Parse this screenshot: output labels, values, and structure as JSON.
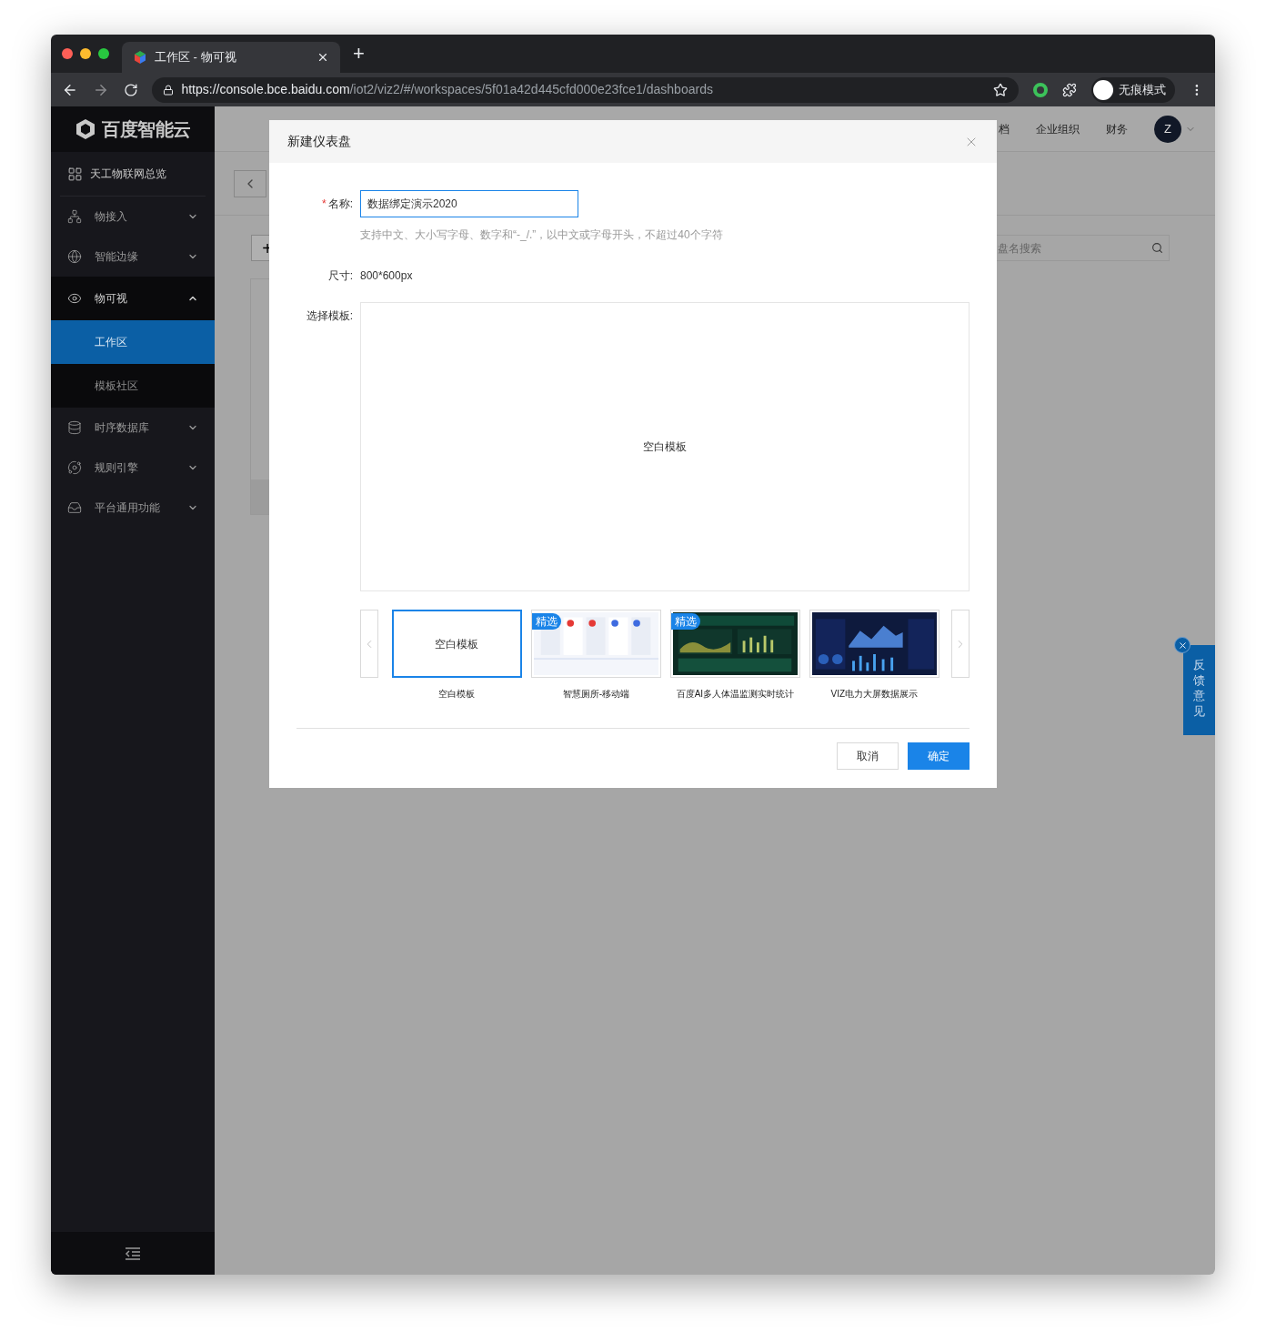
{
  "browser": {
    "tab_title": "工作区 - 物可视",
    "new_tab": "+",
    "url_host": "https://console.bce.baidu.com",
    "url_path": "/iot2/viz2/#/workspaces/5f01a42d445cfd000e23fce1/dashboards",
    "profile": "无痕模式"
  },
  "sidebar": {
    "logo": "百度智能云",
    "overview": "天工物联网总览",
    "items": [
      {
        "label": "物接入",
        "expanded": false
      },
      {
        "label": "智能边缘",
        "expanded": false
      },
      {
        "label": "物可视",
        "expanded": true,
        "children": [
          {
            "label": "工作区",
            "selected": true
          },
          {
            "label": "模板社区",
            "selected": false
          }
        ]
      },
      {
        "label": "时序数据库",
        "expanded": false
      },
      {
        "label": "规则引擎",
        "expanded": false
      },
      {
        "label": "平台通用功能",
        "expanded": false
      }
    ]
  },
  "header": {
    "links": [
      "档",
      "企业组织",
      "财务"
    ],
    "avatar": "Z"
  },
  "background": {
    "add_button": "+",
    "search_placeholder": "盘名搜索"
  },
  "dialog": {
    "title": "新建仪表盘",
    "required_mark": "*",
    "name_label": "名称:",
    "name_value": "数据绑定演示2020",
    "name_hint": "支持中文、大小写字母、数字和“-_/.”，以中文或字母开头，不超过40个字符",
    "size_label": "尺寸:",
    "size_value": "800*600px",
    "template_label": "选择模板:",
    "preview": "空白模板",
    "templates": [
      {
        "kind": "blank",
        "thumb_text": "空白模板",
        "name": "空白模板",
        "selected": true
      },
      {
        "kind": "light",
        "badge": "精选",
        "name": "智慧厕所-移动端",
        "selected": false
      },
      {
        "kind": "green",
        "badge": "精选",
        "name": "百度AI多人体温监测实时统计",
        "selected": false
      },
      {
        "kind": "navy",
        "name": "VIZ电力大屏数据展示",
        "selected": false
      }
    ],
    "cancel": "取消",
    "ok": "确定"
  },
  "feedback": "反馈意见"
}
